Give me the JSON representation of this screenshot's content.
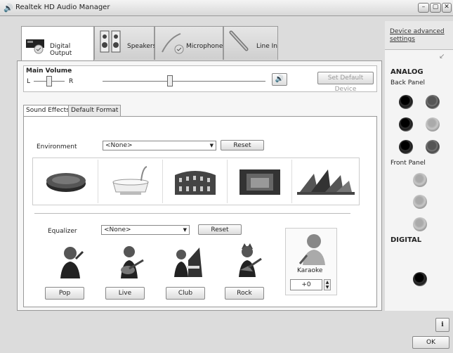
{
  "window": {
    "title": "Realtek HD Audio Manager",
    "minimize": "–",
    "restore": "▢",
    "close": "✕"
  },
  "device_tabs": [
    {
      "label": "Digital Output",
      "active": true,
      "icon": "digital-output-icon"
    },
    {
      "label": "Speakers",
      "active": false,
      "icon": "speakers-icon"
    },
    {
      "label": "Microphone",
      "active": false,
      "icon": "microphone-icon"
    },
    {
      "label": "Line In",
      "active": false,
      "icon": "line-in-icon"
    }
  ],
  "volume": {
    "title": "Main Volume",
    "left_label": "L",
    "right_label": "R",
    "balance_pct": 50,
    "level_pct": 40,
    "set_default_label": "Set Default Device"
  },
  "subtabs": [
    {
      "label": "Sound Effects",
      "active": true
    },
    {
      "label": "Default Format",
      "active": false
    }
  ],
  "environment": {
    "label": "Environment",
    "value": "<None>",
    "reset_label": "Reset",
    "items": [
      "stone-disc",
      "bathtub",
      "colosseum",
      "stone-room",
      "opera-house"
    ]
  },
  "equalizer": {
    "label": "Equalizer",
    "value": "<None>",
    "reset_label": "Reset",
    "presets": [
      {
        "label": "Pop",
        "icon": "pop-singer-icon"
      },
      {
        "label": "Live",
        "icon": "live-guitarist-icon"
      },
      {
        "label": "Club",
        "icon": "club-pianist-icon"
      },
      {
        "label": "Rock",
        "icon": "rock-guitarist-icon"
      }
    ]
  },
  "karaoke": {
    "label": "Karaoke",
    "value": "+0"
  },
  "sidebar": {
    "advanced_link": "Device advanced settings",
    "analog_label": "ANALOG",
    "back_panel_label": "Back Panel",
    "front_panel_label": "Front Panel",
    "digital_label": "DIGITAL"
  },
  "footer": {
    "ok_label": "OK",
    "info_icon": "info-icon"
  }
}
